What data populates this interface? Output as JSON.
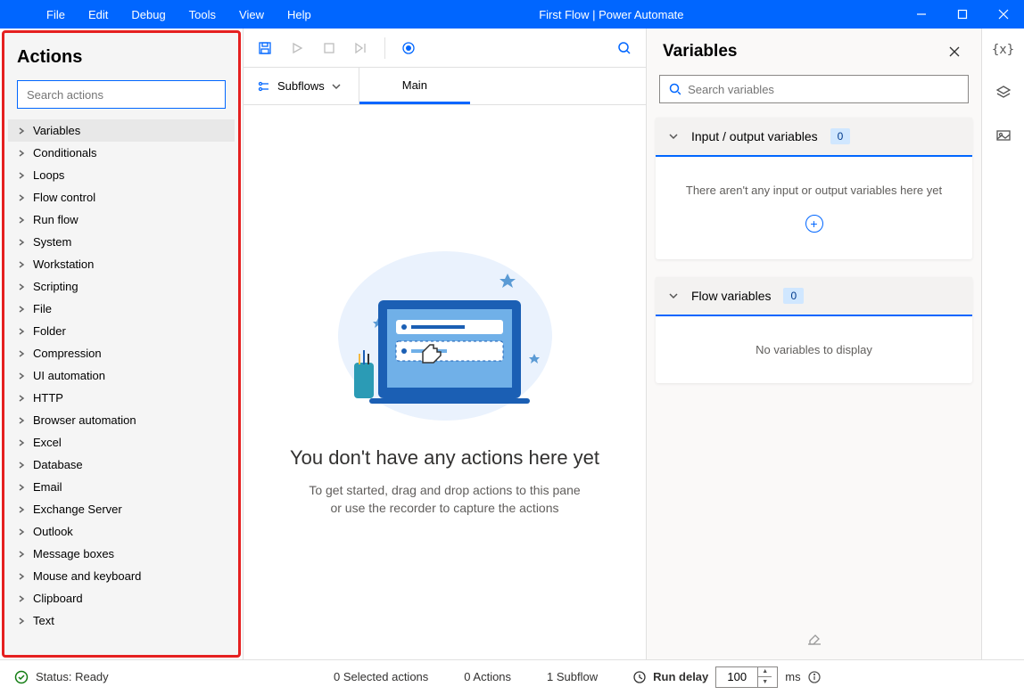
{
  "titlebar": {
    "menu": [
      "File",
      "Edit",
      "Debug",
      "Tools",
      "View",
      "Help"
    ],
    "title": "First Flow | Power Automate"
  },
  "actions": {
    "title": "Actions",
    "search_placeholder": "Search actions",
    "categories": [
      "Variables",
      "Conditionals",
      "Loops",
      "Flow control",
      "Run flow",
      "System",
      "Workstation",
      "Scripting",
      "File",
      "Folder",
      "Compression",
      "UI automation",
      "HTTP",
      "Browser automation",
      "Excel",
      "Database",
      "Email",
      "Exchange Server",
      "Outlook",
      "Message boxes",
      "Mouse and keyboard",
      "Clipboard",
      "Text"
    ],
    "selected_index": 0
  },
  "center": {
    "subflows_label": "Subflows",
    "tabs": [
      "Main"
    ],
    "empty_title": "You don't have any actions here yet",
    "empty_sub1": "To get started, drag and drop actions to this pane",
    "empty_sub2": "or use the recorder to capture the actions"
  },
  "variables": {
    "title": "Variables",
    "search_placeholder": "Search variables",
    "io_section": {
      "label": "Input / output variables",
      "count": "0",
      "empty": "There aren't any input or output variables here yet"
    },
    "flow_section": {
      "label": "Flow variables",
      "count": "0",
      "empty": "No variables to display"
    }
  },
  "status": {
    "ready": "Status: Ready",
    "selected": "0 Selected actions",
    "actions": "0 Actions",
    "subflows": "1 Subflow",
    "run_delay_label": "Run delay",
    "run_delay_value": "100",
    "ms": "ms"
  }
}
